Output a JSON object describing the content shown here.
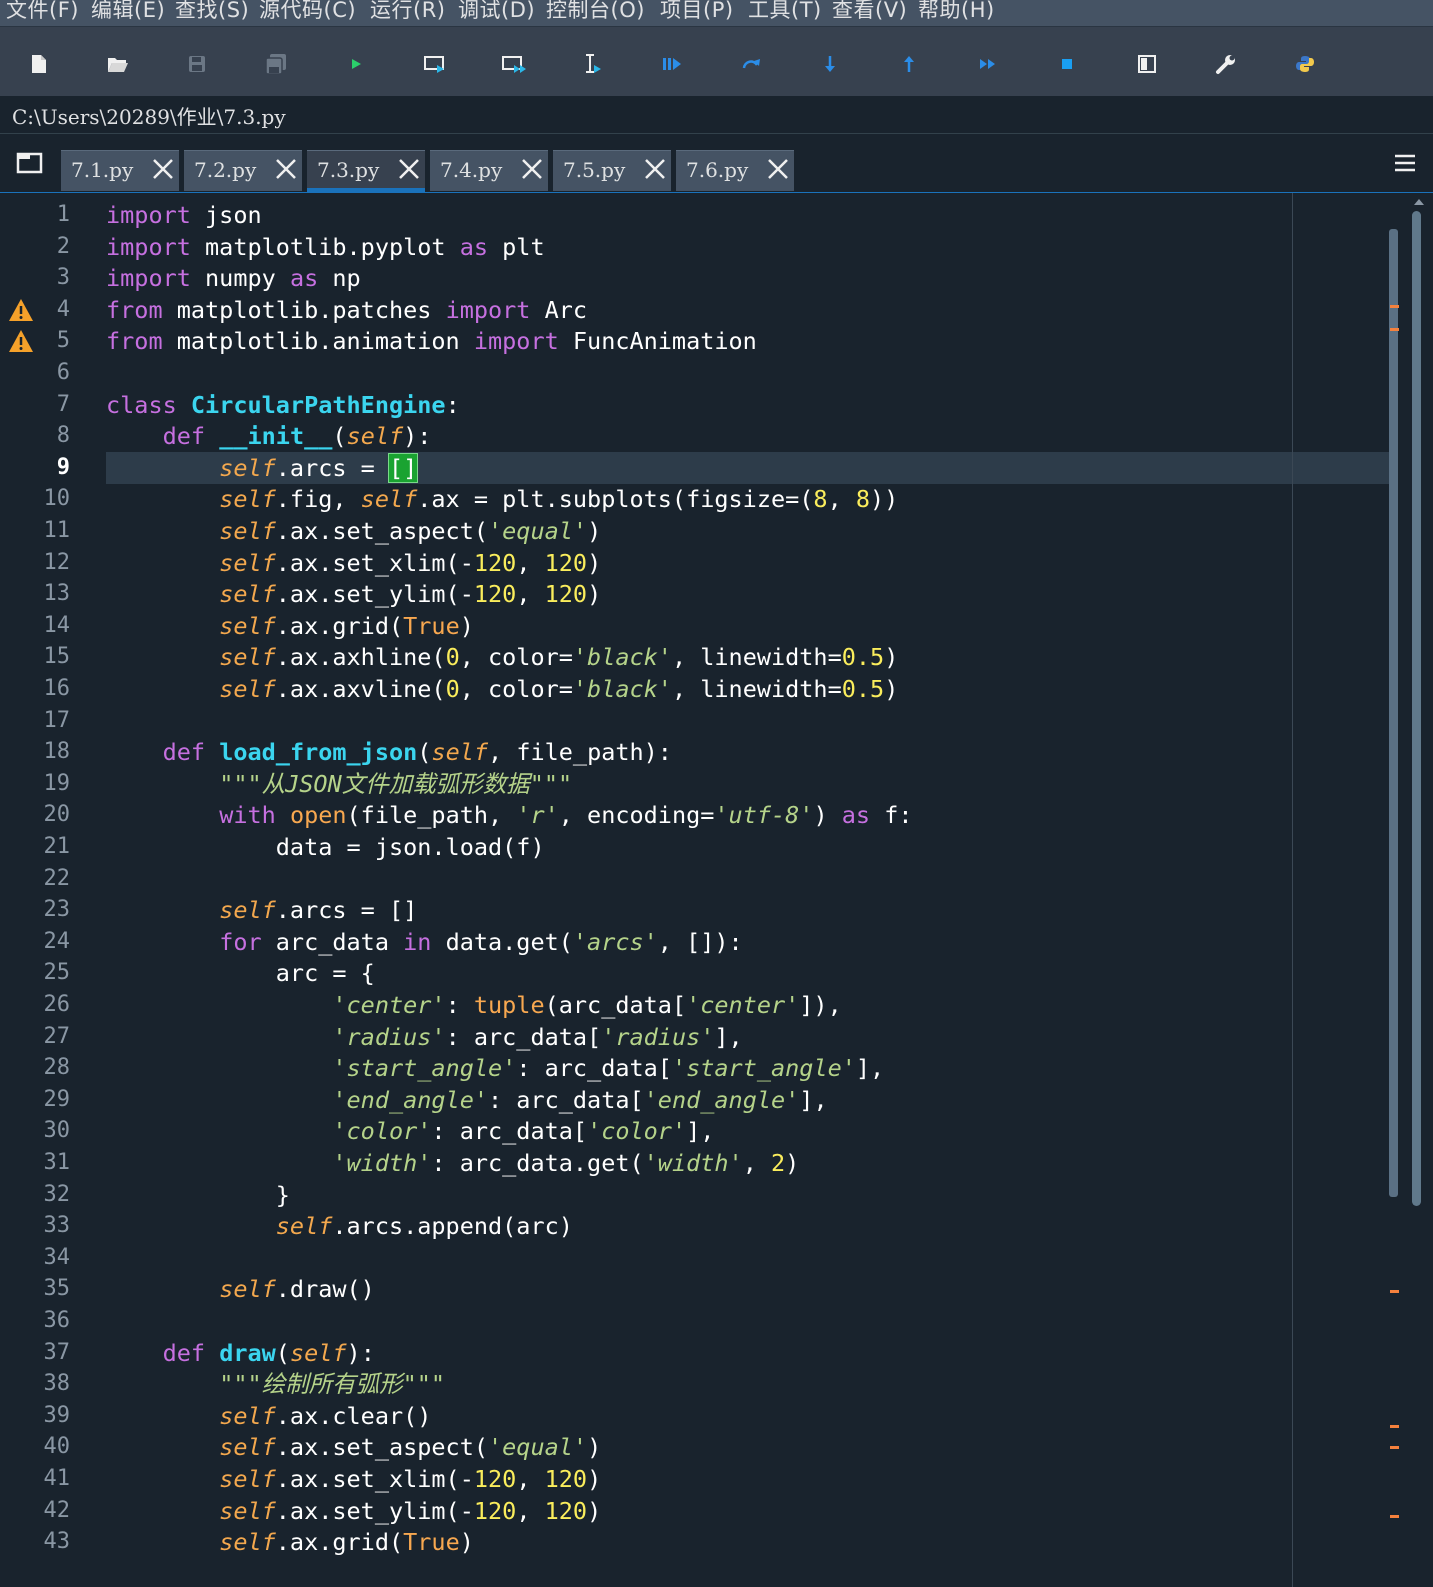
{
  "menubar": [
    "文件(F)",
    "编辑(E)",
    "查找(S)",
    "源代码(C)",
    "运行(R)",
    "调试(D)",
    "控制台(O)",
    "项目(P)",
    "工具(T)",
    "查看(V)",
    "帮助(H)"
  ],
  "toolbar": {
    "icons": [
      "new-file-icon",
      "open-file-icon",
      "save-file-icon",
      "save-all-icon",
      "run-icon",
      "run-cell-icon",
      "run-cell-advance-icon",
      "run-selection-icon",
      "debug-icon",
      "debug-step-over-icon",
      "debug-step-into-icon",
      "debug-step-return-icon",
      "debug-continue-icon",
      "debug-stop-icon",
      "maximize-pane-icon",
      "preferences-icon",
      "pythonpath-manager-icon"
    ],
    "colors": {
      "accent": "#1a72bb",
      "run": "#2bb7e8",
      "stop": "#1a9ff2"
    }
  },
  "path": "C:\\Users\\20289\\作业\\7.3.py",
  "tabs": [
    {
      "label": "7.1.py",
      "active": false
    },
    {
      "label": "7.2.py",
      "active": false
    },
    {
      "label": "7.3.py",
      "active": true
    },
    {
      "label": "7.4.py",
      "active": false
    },
    {
      "label": "7.5.py",
      "active": false
    },
    {
      "label": "7.6.py",
      "active": false
    }
  ],
  "editor": {
    "current_line": 9,
    "warning_lines": [
      4,
      5
    ],
    "line_numbers": [
      "1",
      "2",
      "3",
      "4",
      "5",
      "6",
      "7",
      "8",
      "9",
      "10",
      "11",
      "12",
      "13",
      "14",
      "15",
      "16",
      "17",
      "18",
      "19",
      "20",
      "21",
      "22",
      "23",
      "24",
      "25",
      "26",
      "27",
      "28",
      "29",
      "30",
      "31",
      "32",
      "33",
      "34",
      "35",
      "36",
      "37",
      "38",
      "39",
      "40",
      "41",
      "42",
      "43"
    ],
    "lines": [
      "import json",
      "import matplotlib.pyplot as plt",
      "import numpy as np",
      "from matplotlib.patches import Arc",
      "from matplotlib.animation import FuncAnimation",
      "",
      "class CircularPathEngine:",
      "    def __init__(self):",
      "        self.arcs = []",
      "        self.fig, self.ax = plt.subplots(figsize=(8, 8))",
      "        self.ax.set_aspect('equal')",
      "        self.ax.set_xlim(-120, 120)",
      "        self.ax.set_ylim(-120, 120)",
      "        self.ax.grid(True)",
      "        self.ax.axhline(0, color='black', linewidth=0.5)",
      "        self.ax.axvline(0, color='black', linewidth=0.5)",
      "",
      "    def load_from_json(self, file_path):",
      "        \"\"\"从JSON文件加载弧形数据\"\"\"",
      "        with open(file_path, 'r', encoding='utf-8') as f:",
      "            data = json.load(f)",
      "",
      "        self.arcs = []",
      "        for arc_data in data.get('arcs', []):",
      "            arc = {",
      "                'center': tuple(arc_data['center']),",
      "                'radius': arc_data['radius'],",
      "                'start_angle': arc_data['start_angle'],",
      "                'end_angle': arc_data['end_angle'],",
      "                'color': arc_data['color'],",
      "                'width': arc_data.get('width', 2)",
      "            }",
      "            self.arcs.append(arc)",
      "",
      "        self.draw()",
      "",
      "    def draw(self):",
      "        \"\"\"绘制所有弧形\"\"\"",
      "        self.ax.clear()",
      "        self.ax.set_aspect('equal')",
      "        self.ax.set_xlim(-120, 120)",
      "        self.ax.set_ylim(-120, 120)",
      "        self.ax.grid(True)"
    ]
  }
}
